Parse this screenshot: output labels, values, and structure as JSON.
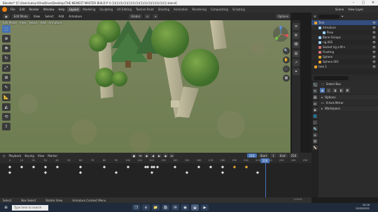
{
  "window": {
    "title": "Blender* [C:\\Users\\utsuri\\OneDrive\\Desktop\\THE NEWEST MASTER BUILD P 4 (1)(1)(1)(1)(1)(1)(1)(1)(1)(1)(1)(1)(1)(1).blend]",
    "minimize": "–",
    "maximize": "□",
    "close": "✕"
  },
  "menubar": {
    "menus": [
      "File",
      "Edit",
      "Render",
      "Window",
      "Help"
    ],
    "workspaces": [
      "Layout",
      "Modeling",
      "Sculpting",
      "UV Editing",
      "Texture Paint",
      "Shading",
      "Animation",
      "Rendering",
      "Compositing",
      "Scripting"
    ],
    "active_workspace": "Layout",
    "scene_label": "Scene",
    "view_layer_label": "View Layer"
  },
  "viewport": {
    "mode": "Edit Mode",
    "menus": [
      "View",
      "Select",
      "Add",
      "Armature"
    ],
    "transform_orientation": "Global",
    "options_label": "Options",
    "edit_mode_tab": "Edit Mode"
  },
  "timeline": {
    "menus": [
      "Playback",
      "Keying",
      "View",
      "Marker"
    ],
    "current_frame": "216",
    "frame_field": "216",
    "start_label": "Start",
    "start_value": "1",
    "end_label": "End",
    "end_value": "250",
    "ticks": [
      "0",
      "10",
      "20",
      "30",
      "40",
      "50",
      "60",
      "70",
      "80",
      "90",
      "100",
      "110",
      "120",
      "130",
      "140",
      "150",
      "160",
      "170",
      "180",
      "190",
      "200",
      "210",
      "220",
      "230",
      "240",
      "250"
    ],
    "keyframes_row1": [
      0,
      10,
      20,
      30,
      40,
      60,
      80,
      100,
      115,
      117,
      120,
      122,
      125,
      140,
      160,
      170,
      180,
      200
    ],
    "keyframes_row2": [
      0,
      30,
      60,
      90,
      120,
      150,
      180,
      210
    ],
    "keyframes_sel": [
      190,
      200
    ]
  },
  "statusbar": {
    "items": [
      "Select",
      "Box Select",
      "Rotate View",
      "Armature Context Menu"
    ],
    "version": "2.93.0"
  },
  "outliner": {
    "search_placeholder": "",
    "rows": [
      {
        "label": "Tree",
        "indent": 0,
        "color": "#e8a32e"
      },
      {
        "label": "Armature",
        "indent": 1,
        "color": "#9bd0ff"
      },
      {
        "label": "Pose",
        "indent": 2,
        "color": "#9bd0ff"
      },
      {
        "label": "Bone Groups",
        "indent": 1,
        "color": "#9bd0ff"
      },
      {
        "label": "rig.002",
        "indent": 1,
        "color": "#9bd0ff"
      },
      {
        "label": "Socket rig a M-s",
        "indent": 1,
        "color": "#d67373"
      },
      {
        "label": "Floating",
        "indent": 1,
        "color": "#d67373"
      },
      {
        "label": "Sphere",
        "indent": 1,
        "color": "#e8a32e"
      },
      {
        "label": "Sphere.001",
        "indent": 1,
        "color": "#e8a32e"
      },
      {
        "label": "tree 1",
        "indent": 0,
        "color": "#e8a32e"
      }
    ],
    "selected_row": 0
  },
  "properties": {
    "tool_name": "Select Box",
    "sections": [
      "Options",
      "X-Axis Mirror",
      "Workspace"
    ]
  },
  "taskbar": {
    "search_placeholder": "Type here to search",
    "time": "20:16",
    "date": "12/02/2021"
  }
}
